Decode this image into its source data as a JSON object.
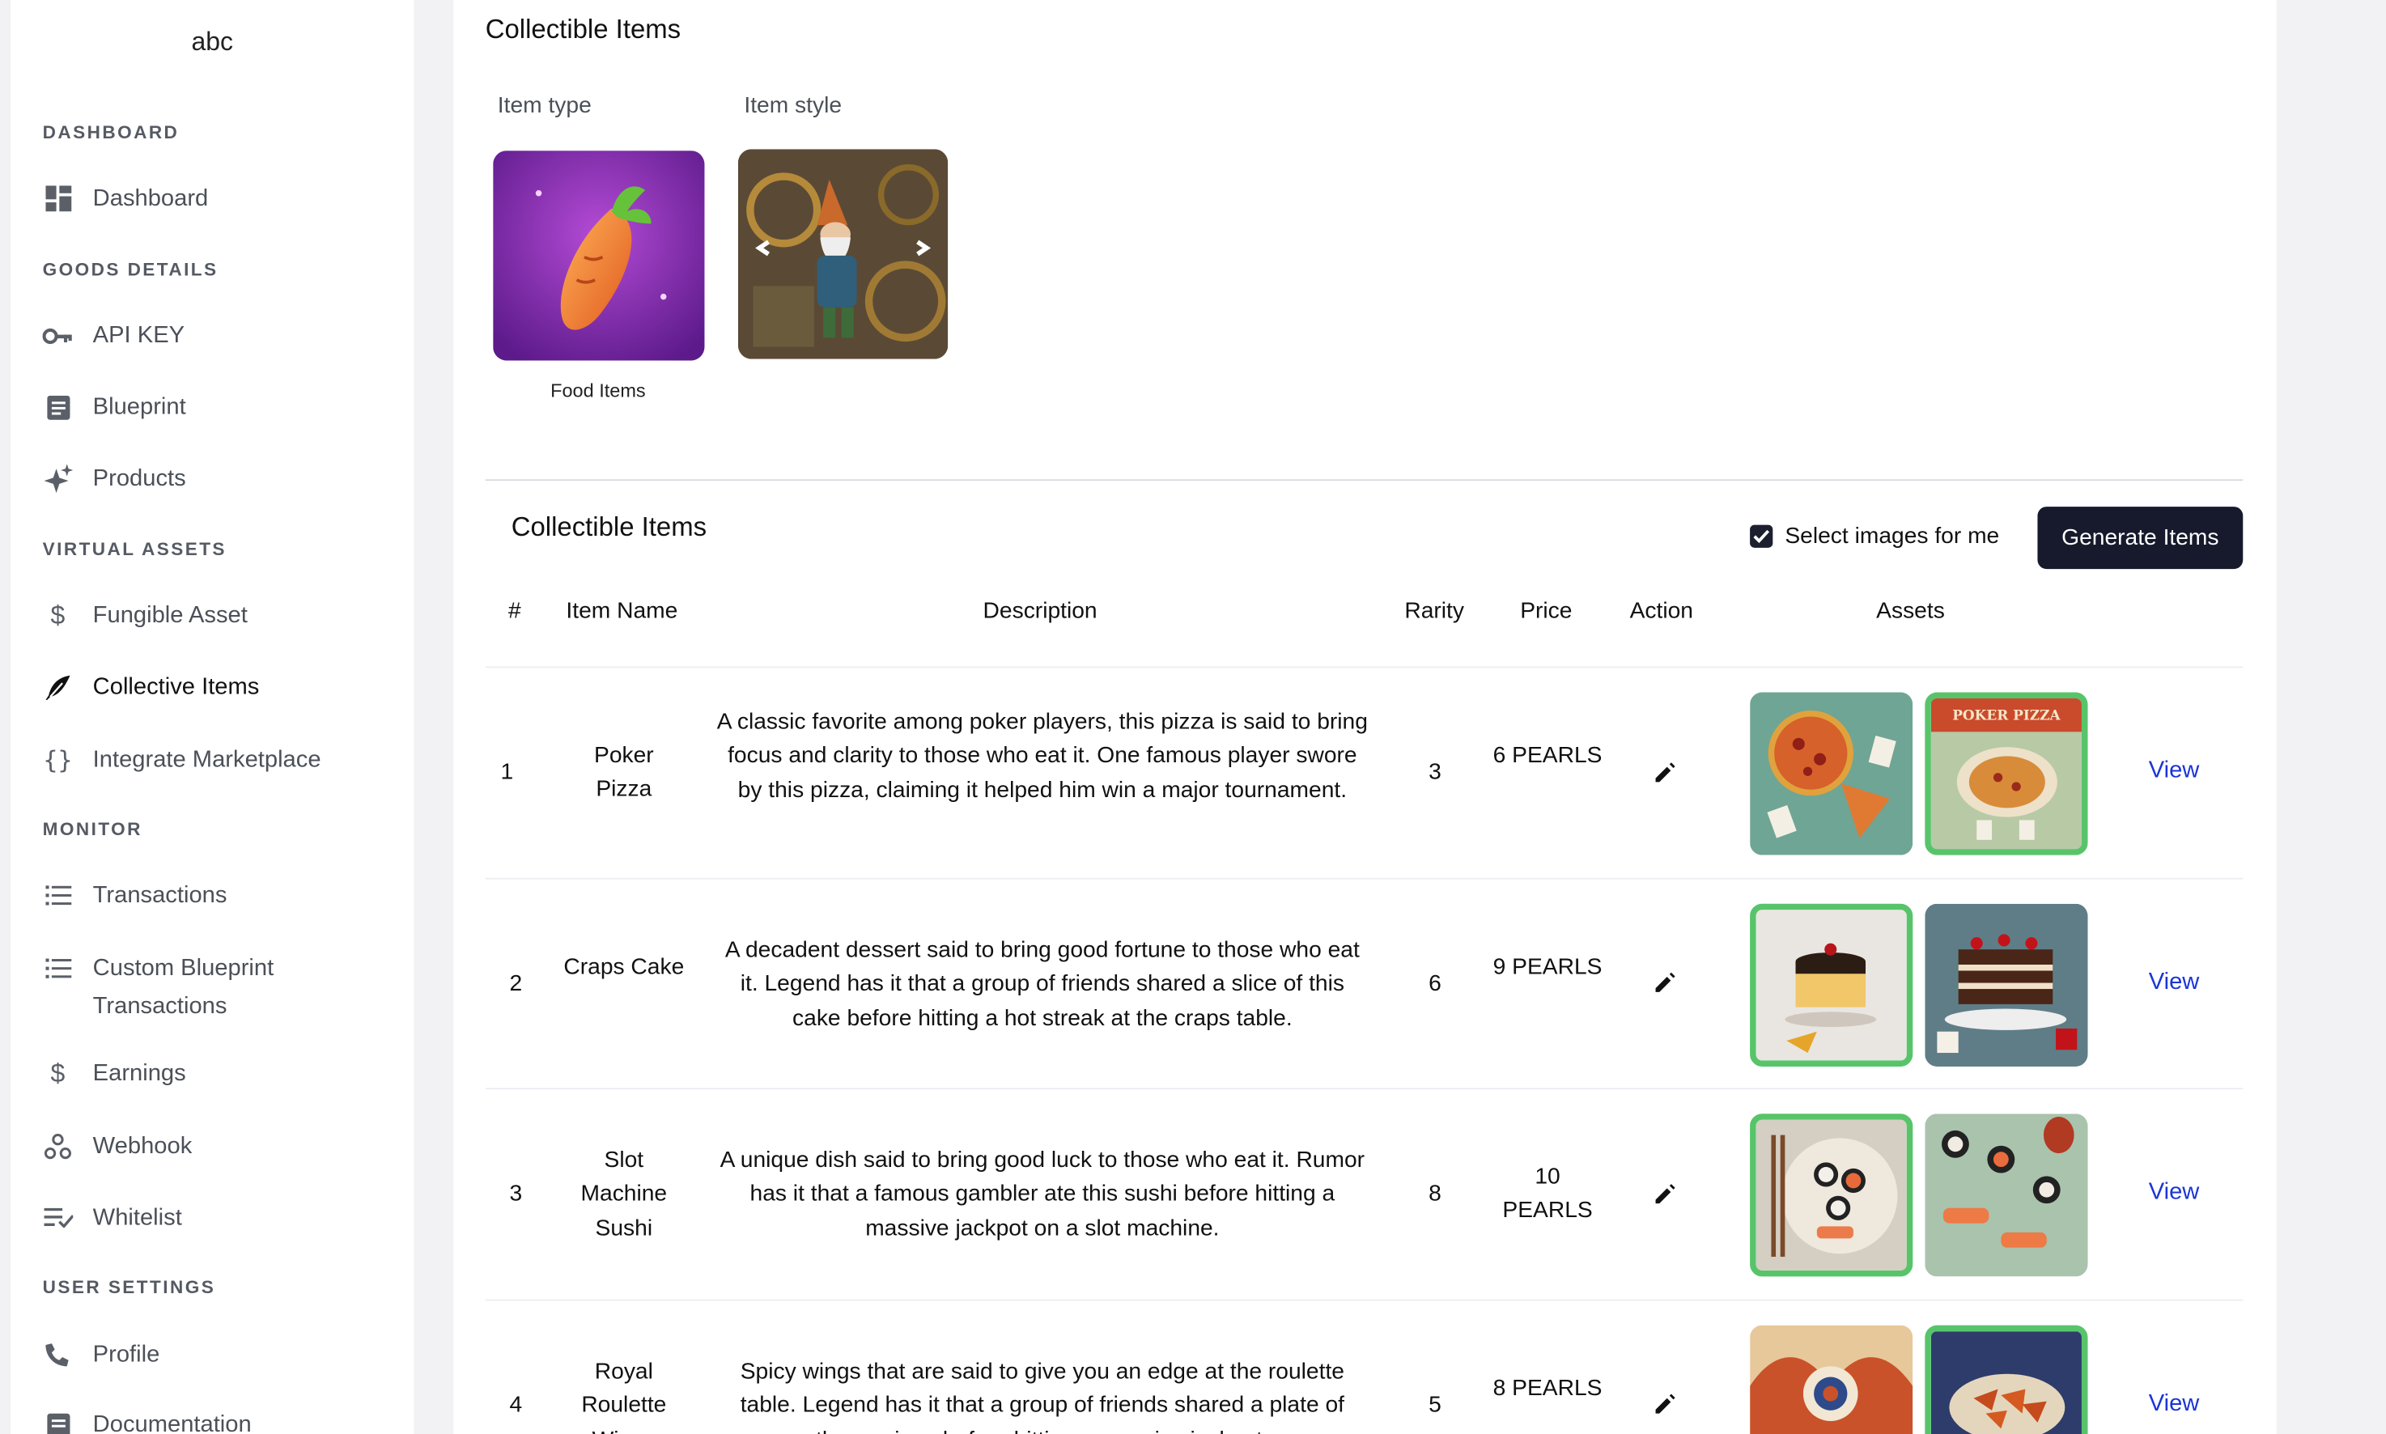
{
  "brand": "abc",
  "sidebar": {
    "sections": [
      {
        "label": "DASHBOARD"
      },
      {
        "label": "GOODS DETAILS"
      },
      {
        "label": "VIRTUAL ASSETS"
      },
      {
        "label": "MONITOR"
      },
      {
        "label": "USER SETTINGS"
      }
    ],
    "items": [
      {
        "label": "Dashboard",
        "icon": "dashboard-icon"
      },
      {
        "label": "API KEY",
        "icon": "key-icon"
      },
      {
        "label": "Blueprint",
        "icon": "document-icon"
      },
      {
        "label": "Products",
        "icon": "sparkle-icon"
      },
      {
        "label": "Fungible Asset",
        "icon": "dollar-icon"
      },
      {
        "label": "Collective Items",
        "icon": "feather-icon",
        "active": true
      },
      {
        "label": "Integrate Marketplace",
        "icon": "braces-icon"
      },
      {
        "label": "Transactions",
        "icon": "list-icon"
      },
      {
        "label": "Custom Blueprint Transactions",
        "icon": "list-icon"
      },
      {
        "label": "Earnings",
        "icon": "dollar-icon"
      },
      {
        "label": "Webhook",
        "icon": "webhook-icon"
      },
      {
        "label": "Whitelist",
        "icon": "checklist-icon"
      },
      {
        "label": "Profile",
        "icon": "phone-person-icon"
      },
      {
        "label": "Documentation",
        "icon": "document-icon"
      }
    ]
  },
  "main": {
    "title": "Collectible Items",
    "item_type_label": "Item type",
    "item_style_label": "Item style",
    "item_type_caption": "Food Items",
    "table_title": "Collectible Items",
    "select_images_label": "Select images for me",
    "select_images_checked": true,
    "generate_button": "Generate Items",
    "columns": [
      "#",
      "Item Name",
      "Description",
      "Rarity",
      "Price",
      "Action",
      "Assets"
    ],
    "rows": [
      {
        "num": "1",
        "name": "Poker Pizza",
        "description": "A classic favorite among poker players, this pizza is said to bring focus and clarity to those who eat it. One famous player swore by this pizza, claiming it helped him win a major tournament.",
        "rarity": "3",
        "price": "6 PEARLS",
        "view": "View"
      },
      {
        "num": "2",
        "name": "Craps Cake",
        "description": "A decadent dessert said to bring good fortune to those who eat it. Legend has it that a group of friends shared a slice of this cake before hitting a hot streak at the craps table.",
        "rarity": "6",
        "price": "9 PEARLS",
        "view": "View"
      },
      {
        "num": "3",
        "name": "Slot Machine Sushi",
        "description": "A unique dish said to bring good luck to those who eat it. Rumor has it that a famous gambler ate this sushi before hitting a massive jackpot on a slot machine.",
        "rarity": "8",
        "price": "10 PEARLS",
        "view": "View"
      },
      {
        "num": "4",
        "name": "Royal Roulette Wings",
        "description": "Spicy wings that are said to give you an edge at the roulette table. Legend has it that a group of friends shared a plate of these wings before hitting a massive jackpot.",
        "rarity": "5",
        "price": "8 PEARLS",
        "view": "View"
      }
    ],
    "pizza_label": "POKER PIZZA"
  },
  "colors": {
    "accent": "#161a2c",
    "selected_border": "#58c46a",
    "link": "#1a35d6",
    "sidebar_bg": "#ffffff",
    "page_bg": "#f2f2f4"
  }
}
